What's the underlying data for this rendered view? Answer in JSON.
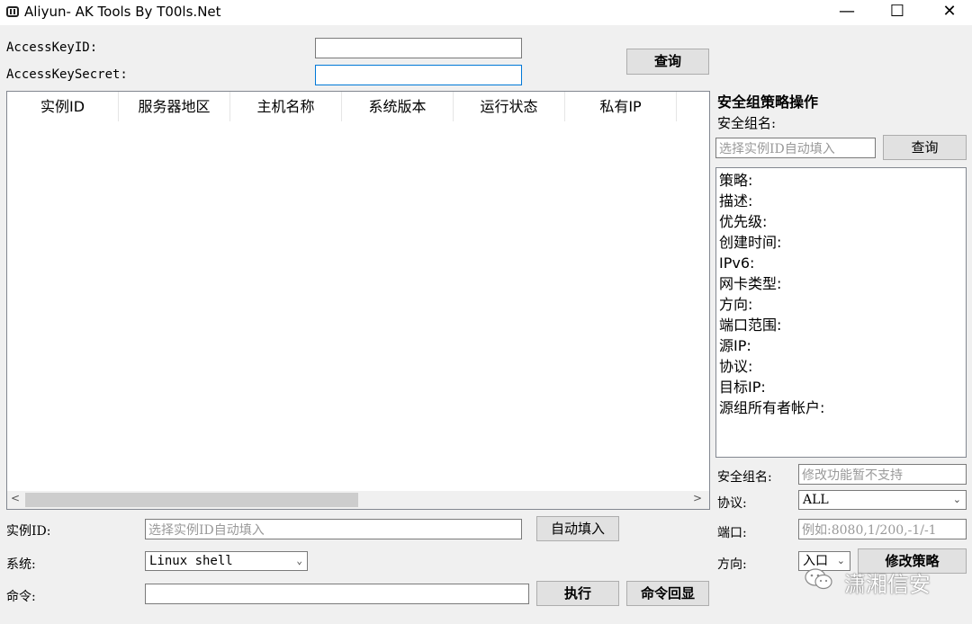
{
  "window": {
    "title": "Aliyun- AK Tools By T00ls.Net",
    "minimize_glyph": "—",
    "maximize_glyph": "☐",
    "close_glyph": "✕"
  },
  "credentials": {
    "accesskey_id_label": "AccessKeyID:",
    "accesskey_secret_label": "AccessKeySecret:",
    "accesskey_id_value": "",
    "accesskey_secret_value": "",
    "query_label": "查询"
  },
  "table": {
    "columns": [
      "实例ID",
      "服务器地区",
      "主机名称",
      "系统版本",
      "运行状态",
      "私有IP"
    ],
    "rows": [],
    "scroll_left_glyph": "<",
    "scroll_right_glyph": ">"
  },
  "command_panel": {
    "instance_id_label": "实例ID:",
    "instance_id_placeholder": "选择实例ID自动填入",
    "autofill_label": "自动填入",
    "system_label": "系统:",
    "system_value": "Linux shell",
    "command_label": "命令:",
    "command_value": "",
    "execute_label": "执行",
    "echo_label": "命令回显"
  },
  "security_group": {
    "section_title": "安全组策略操作",
    "group_name_label": "安全组名:",
    "group_name_placeholder": "选择实例ID自动填入",
    "query_label": "查询",
    "info_fields": [
      "策略:",
      "描述:",
      "优先级:",
      "创建时间:",
      "IPv6:",
      "网卡类型:",
      "方向:",
      "端口范围:",
      "源IP:",
      "协议:",
      "目标IP:",
      "源组所有者帐户:"
    ],
    "edit_group_name_label": "安全组名:",
    "edit_group_name_placeholder": "修改功能暂不支持",
    "protocol_label": "协议:",
    "protocol_value": "ALL",
    "port_label": "端口:",
    "port_placeholder": "例如:8080,1/200,-1/-1",
    "direction_label": "方向:",
    "direction_value": "入口",
    "modify_label": "修改策略"
  },
  "watermark": {
    "text": "潇湘信安",
    "icon": "wechat-icon"
  }
}
